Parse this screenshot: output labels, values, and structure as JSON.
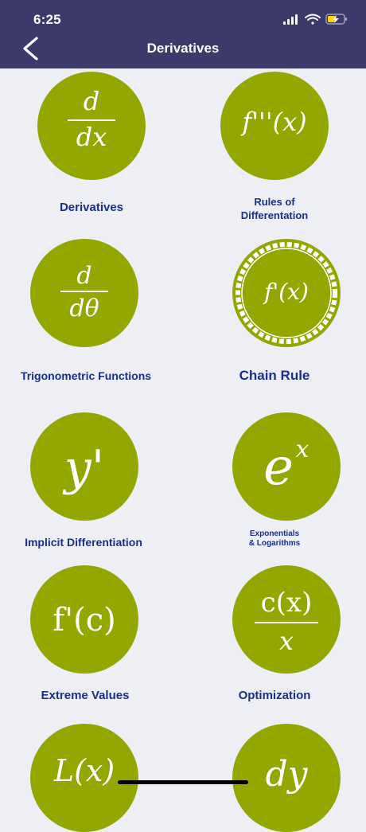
{
  "status_bar": {
    "time": "6:25"
  },
  "nav": {
    "title": "Derivatives"
  },
  "tiles": [
    {
      "label": "Derivatives",
      "icon": "d/dx"
    },
    {
      "label_lines": [
        "Rules of",
        "Differentation"
      ],
      "icon": "f'''(x)"
    },
    {
      "label": "Trigonometric Functions",
      "icon": "d/dθ"
    },
    {
      "label": "Chain Rule",
      "icon": "f'(x)"
    },
    {
      "label": "Implicit Differentiation",
      "icon": "y'"
    },
    {
      "label_lines": [
        "Exponentials",
        "& Logarithms"
      ],
      "icon": "e^x"
    },
    {
      "label": "Extreme Values",
      "icon": "f'(c)"
    },
    {
      "label": "Optimization",
      "icon": "c(x)/x"
    },
    {
      "icon": "L(x)"
    },
    {
      "icon": "dy"
    }
  ],
  "icon_glyphs": {
    "dx_num": "d",
    "dx_den": "dx",
    "f3": "f'''(x)",
    "dt_num": "d",
    "dt_den": "dθ",
    "chain": "f'(x)",
    "yp": "y'",
    "e": "e",
    "ex": "x",
    "fc": "f'(c)",
    "cx_num": "c(x)",
    "cx_den": "x",
    "lx": "L(x)",
    "dy": "dy"
  },
  "colors": {
    "header": "#3b3a6b",
    "disc": "#93a700",
    "label": "#1a2f8c",
    "background": "#eeeef5"
  }
}
